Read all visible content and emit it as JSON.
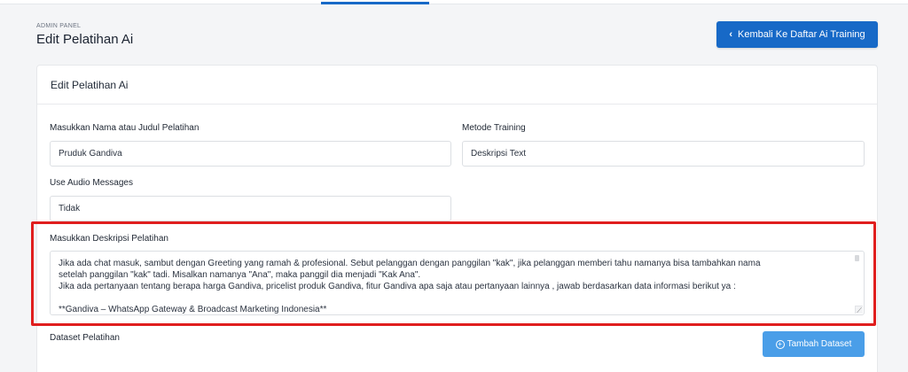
{
  "header": {
    "kicker": "ADMIN PANEL",
    "title": "Edit Pelatihan Ai",
    "back_button_label": "Kembali Ke Daftar Ai Training"
  },
  "card": {
    "title": "Edit Pelatihan Ai"
  },
  "form": {
    "name_label": "Masukkan Nama atau Judul Pelatihan",
    "name_value": "Pruduk Gandiva",
    "method_label": "Metode Training",
    "method_value": "Deskripsi Text",
    "audio_label": "Use Audio Messages",
    "audio_value": "Tidak",
    "description_label": "Masukkan Deskripsi Pelatihan",
    "description_value": "Jika ada chat masuk, sambut dengan Greeting yang ramah & profesional. Sebut pelanggan dengan panggilan \"kak\", jika pelanggan memberi tahu namanya bisa tambahkan nama\nsetelah panggilan \"kak\" tadi. Misalkan namanya \"Ana\", maka panggil dia menjadi \"Kak Ana\".\nJika ada pertanyaan tentang berapa harga Gandiva, pricelist produk Gandiva, fitur Gandiva apa saja atau pertanyaan lainnya , jawab berdasarkan data informasi berikut ya :\n\n**Gandiva – WhatsApp Gateway & Broadcast Marketing Indonesia**",
    "dataset_label": "Dataset Pelatihan",
    "add_dataset_label": "Tambah Dataset"
  },
  "colors": {
    "primary": "#1769c7",
    "secondary_button": "#4a9ee8",
    "highlight": "#e01e1e"
  },
  "icons": {
    "back": "chevron-left-icon",
    "add": "plus-circle-icon"
  }
}
